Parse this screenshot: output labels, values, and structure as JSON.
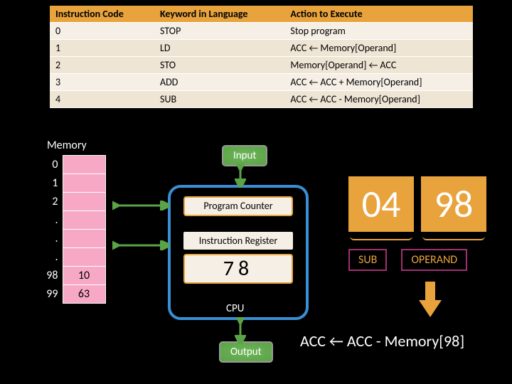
{
  "instr_table": {
    "headers": [
      "Instruction Code",
      "Keyword in Language",
      "Action to Execute"
    ],
    "rows": [
      {
        "code": "0",
        "kw": "STOP",
        "action": "Stop program"
      },
      {
        "code": "1",
        "kw": "LD",
        "action": "ACC ← Memory[Operand]"
      },
      {
        "code": "2",
        "kw": "STO",
        "action": "Memory[Operand] ← ACC"
      },
      {
        "code": "3",
        "kw": "ADD",
        "action": "ACC ← ACC + Memory[Operand]"
      },
      {
        "code": "4",
        "kw": "SUB",
        "action": "ACC ← ACC - Memory[Operand]"
      }
    ]
  },
  "memory": {
    "label": "Memory",
    "rows": [
      {
        "addr": "0",
        "val": ""
      },
      {
        "addr": "1",
        "val": ""
      },
      {
        "addr": "2",
        "val": ""
      },
      {
        "addr": ".",
        "val": ""
      },
      {
        "addr": ".",
        "val": ""
      },
      {
        "addr": ".",
        "val": ""
      },
      {
        "addr": "98",
        "val": "10"
      },
      {
        "addr": "99",
        "val": "63"
      }
    ]
  },
  "cpu": {
    "input_label": "Input",
    "output_label": "Output",
    "pc_label": "Program Counter",
    "ir_label": "Instruction Register",
    "ir_value": "78",
    "cpu_label": "CPU"
  },
  "big_instr": {
    "opcode": "04",
    "operand": "98"
  },
  "decode": {
    "op_label": "SUB",
    "operand_label": "OPERAND"
  },
  "action_line": "ACC ← ACC - Memory[98]"
}
